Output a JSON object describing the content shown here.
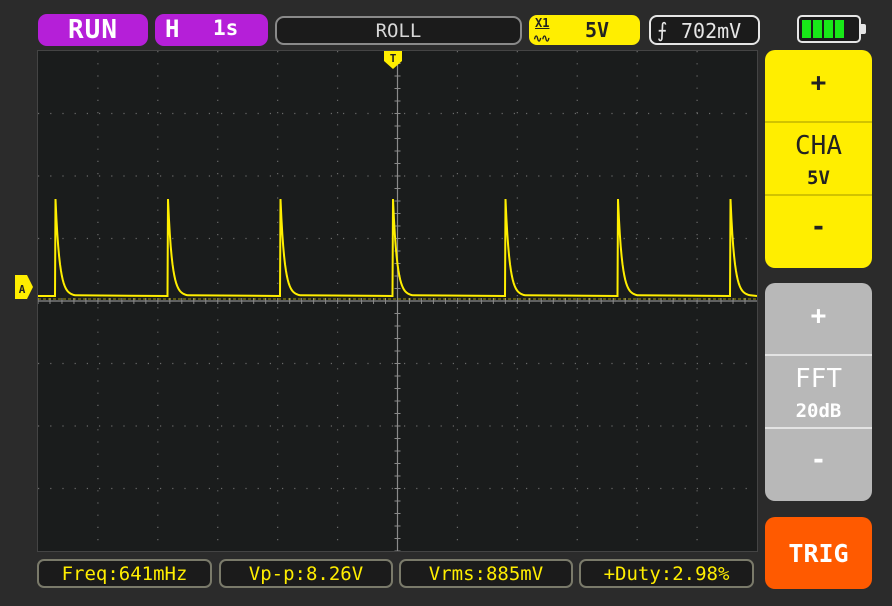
{
  "top_bar": {
    "run_status": "RUN",
    "horizontal_label": "H",
    "timebase": "1s",
    "mode": "ROLL",
    "channel_coupling": "X1",
    "channel_scale": "5V",
    "trigger_level": "702mV",
    "battery_bars": 4
  },
  "markers": {
    "trigger": "T",
    "channel": "A"
  },
  "side_panel": {
    "cha": {
      "plus": "+",
      "title": "CHA",
      "value": "5V",
      "minus": "-"
    },
    "fft": {
      "plus": "+",
      "title": "FFT",
      "value": "20dB",
      "minus": "-"
    },
    "trig_button": "TRIG"
  },
  "measurements": {
    "freq": "Freq:641mHz",
    "vpp": "Vp-p:8.26V",
    "vrms": "Vrms:885mV",
    "duty": "+Duty:2.98%"
  },
  "colors": {
    "trace": "#ffee00",
    "run_badge": "#b51fd8",
    "trig_button": "#ff5a00",
    "battery": "#18e818"
  }
}
